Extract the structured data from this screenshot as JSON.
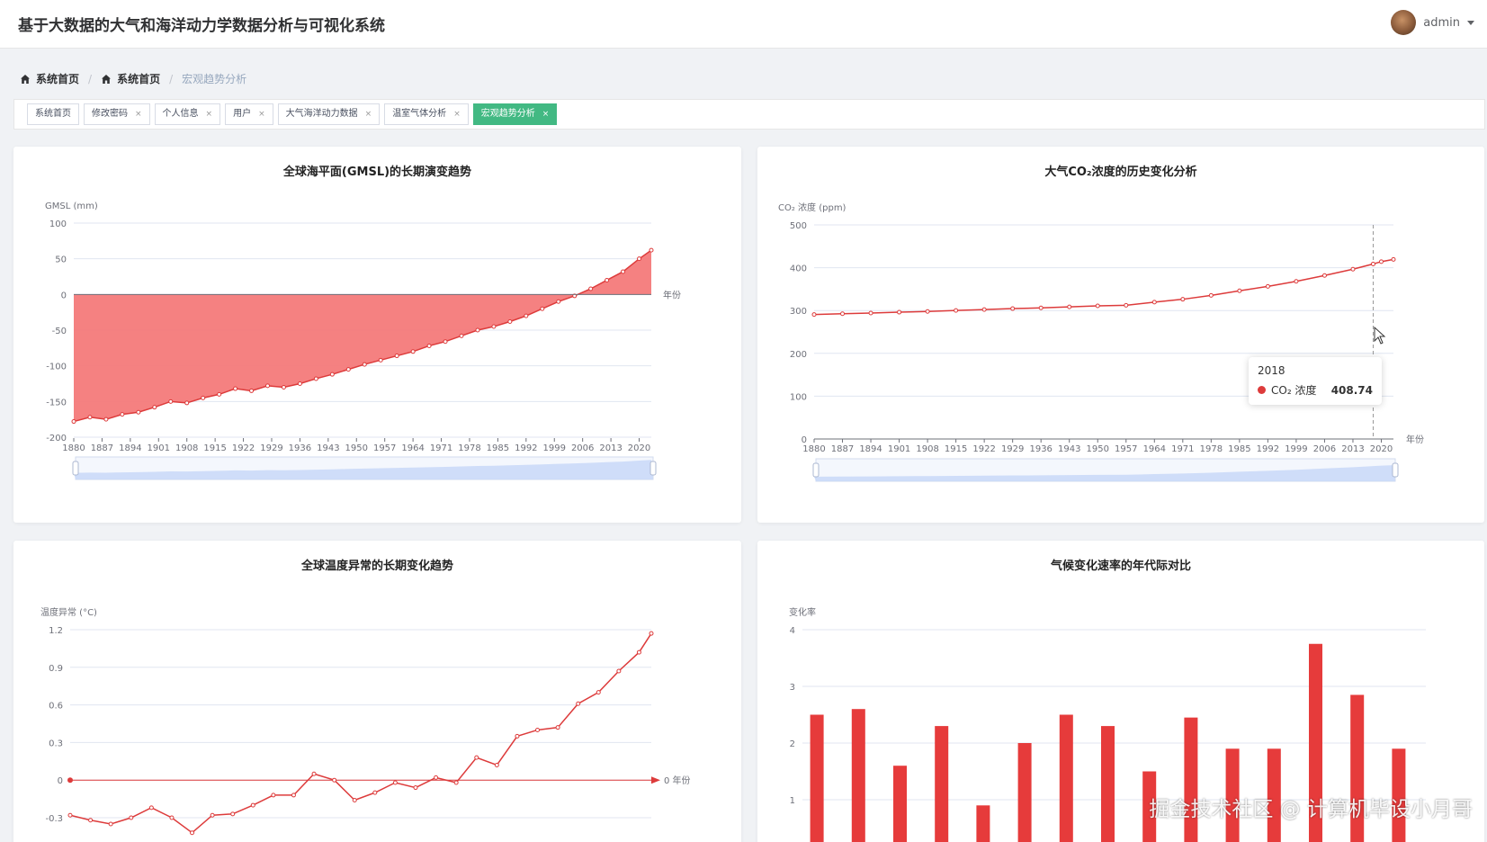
{
  "header": {
    "title": "基于大数据的大气和海洋动力学数据分析与可视化系统",
    "user": "admin"
  },
  "breadcrumb": [
    {
      "label": "系统首页"
    },
    {
      "label": "系统首页"
    },
    {
      "label": "宏观趋势分析"
    }
  ],
  "tags": [
    {
      "label": "系统首页",
      "closable": false,
      "active": false
    },
    {
      "label": "修改密码",
      "closable": true,
      "active": false
    },
    {
      "label": "个人信息",
      "closable": true,
      "active": false
    },
    {
      "label": "用户",
      "closable": true,
      "active": false
    },
    {
      "label": "大气海洋动力数据",
      "closable": true,
      "active": false
    },
    {
      "label": "温室气体分析",
      "closable": true,
      "active": false
    },
    {
      "label": "宏观趋势分析",
      "closable": true,
      "active": true
    }
  ],
  "colors": {
    "series": "#dd3b3b",
    "area": "#f47a7a",
    "active_tag": "#42b983"
  },
  "tooltip": {
    "year": "2018",
    "series": "CO₂ 浓度",
    "value": "408.74"
  },
  "watermark": "掘金技术社区 @ 计算机毕设小月哥",
  "chart_data": [
    {
      "id": "gmsl",
      "type": "area",
      "title": "全球海平面(GMSL)的长期演变趋势",
      "ylabel": "GMSL (mm)",
      "xlabel": "年份",
      "ylim": [
        -200,
        100
      ],
      "yticks": [
        100,
        50,
        0,
        -50,
        -100,
        -150,
        -200
      ],
      "xticks": [
        "1880",
        "1887",
        "1894",
        "1901",
        "1908",
        "1915",
        "1922",
        "1929",
        "1936",
        "1943",
        "1950",
        "1957",
        "1964",
        "1971",
        "1978",
        "1985",
        "1992",
        "1999",
        "2006",
        "2013",
        "2020"
      ],
      "x": [
        1880,
        1884,
        1888,
        1892,
        1896,
        1900,
        1904,
        1908,
        1912,
        1916,
        1920,
        1924,
        1928,
        1932,
        1936,
        1940,
        1944,
        1948,
        1952,
        1956,
        1960,
        1964,
        1968,
        1972,
        1976,
        1980,
        1984,
        1988,
        1992,
        1996,
        2000,
        2004,
        2008,
        2012,
        2016,
        2020,
        2023
      ],
      "values": [
        -178,
        -172,
        -175,
        -168,
        -165,
        -158,
        -150,
        -152,
        -145,
        -140,
        -132,
        -135,
        -128,
        -130,
        -125,
        -118,
        -112,
        -105,
        -98,
        -92,
        -86,
        -80,
        -72,
        -66,
        -58,
        -50,
        -45,
        -38,
        -30,
        -20,
        -10,
        -2,
        8,
        20,
        32,
        50,
        62
      ],
      "grid": true,
      "legend": "none",
      "zoom_slider": true
    },
    {
      "id": "co2",
      "type": "line",
      "title": "大气CO₂浓度的历史变化分析",
      "ylabel": "CO₂ 浓度 (ppm)",
      "xlabel": "年份",
      "ylim": [
        0,
        500
      ],
      "yticks": [
        500,
        400,
        300,
        200,
        100,
        0
      ],
      "xticks": [
        "1880",
        "1887",
        "1894",
        "1901",
        "1908",
        "1915",
        "1922",
        "1929",
        "1936",
        "1943",
        "1950",
        "1957",
        "1964",
        "1971",
        "1978",
        "1985",
        "1992",
        "1999",
        "2006",
        "2013",
        "2020"
      ],
      "x": [
        1880,
        1887,
        1894,
        1901,
        1908,
        1915,
        1922,
        1929,
        1936,
        1943,
        1950,
        1957,
        1964,
        1971,
        1978,
        1985,
        1992,
        1999,
        2006,
        2013,
        2018,
        2020,
        2023
      ],
      "values": [
        290.7,
        292.5,
        294.2,
        296.1,
        297.8,
        300.1,
        302.3,
        304.5,
        306.2,
        308.5,
        310.9,
        312.3,
        319.6,
        326.3,
        335.4,
        346.1,
        356.4,
        368.1,
        381.9,
        396.5,
        408.74,
        414.2,
        419.3
      ],
      "grid": true,
      "legend": "none",
      "zoom_slider": true
    },
    {
      "id": "temp",
      "type": "line",
      "title": "全球温度异常的长期变化趋势",
      "ylabel": "温度异常 (°C)",
      "xlabel": "年份",
      "ylim": [
        -0.3,
        1.2
      ],
      "yticks": [
        1.2,
        0.9,
        0.6,
        0.3,
        0,
        -0.3
      ],
      "x": [
        1880,
        1885,
        1890,
        1895,
        1900,
        1905,
        1910,
        1915,
        1920,
        1925,
        1930,
        1935,
        1940,
        1945,
        1950,
        1955,
        1960,
        1965,
        1970,
        1975,
        1980,
        1985,
        1990,
        1995,
        2000,
        2005,
        2010,
        2015,
        2020,
        2023
      ],
      "values": [
        -0.28,
        -0.32,
        -0.35,
        -0.3,
        -0.22,
        -0.3,
        -0.42,
        -0.28,
        -0.27,
        -0.2,
        -0.12,
        -0.12,
        0.05,
        0.0,
        -0.16,
        -0.1,
        -0.02,
        -0.06,
        0.02,
        -0.02,
        0.18,
        0.12,
        0.35,
        0.4,
        0.42,
        0.61,
        0.7,
        0.87,
        1.02,
        1.17
      ],
      "grid": true,
      "legend": "none"
    },
    {
      "id": "rate",
      "type": "bar",
      "title": "气候变化速率的年代际对比",
      "ylabel": "变化率",
      "ylim": [
        0,
        4
      ],
      "yticks": [
        4,
        3,
        2,
        1
      ],
      "values": [
        2.5,
        2.6,
        1.6,
        2.3,
        0.9,
        2.0,
        2.5,
        2.3,
        1.5,
        2.45,
        1.9,
        1.9,
        3.75,
        2.85,
        1.9
      ],
      "grid": true,
      "legend": "none"
    }
  ]
}
